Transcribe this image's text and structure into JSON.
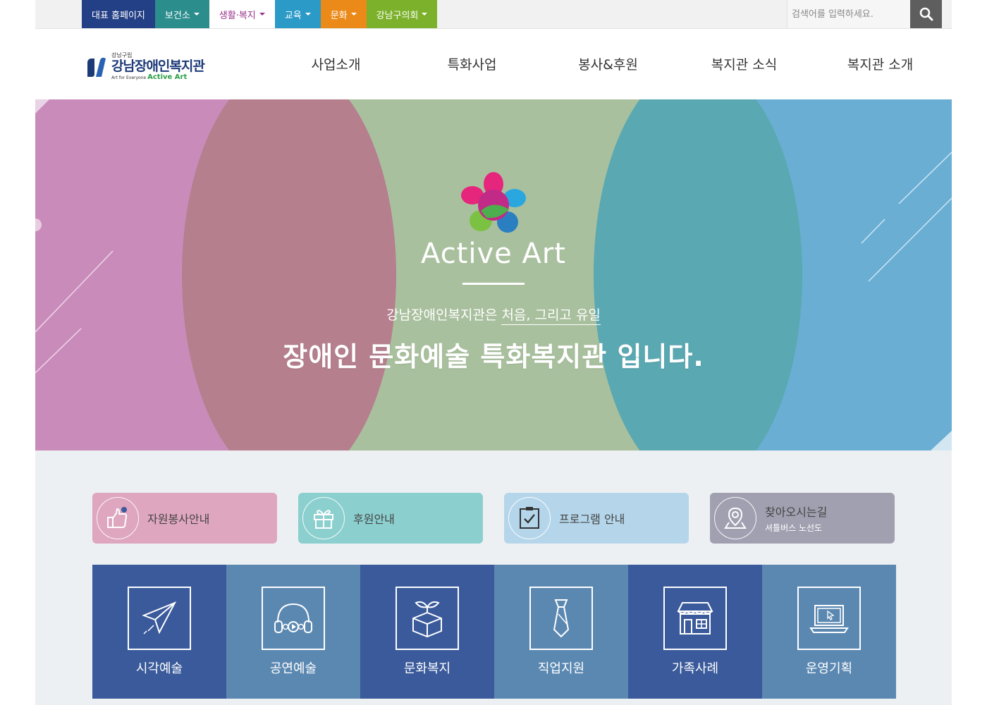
{
  "topnav": [
    {
      "label": "대표 홈페이지",
      "bg": "#233f86",
      "color": "#ffffff",
      "caret": false
    },
    {
      "label": "보건소",
      "bg": "#2c8d8d",
      "color": "#ffffff",
      "caret": true
    },
    {
      "label": "생활·복지",
      "bg": "#ffffff",
      "color": "#9a2f8a",
      "caret": true
    },
    {
      "label": "교육",
      "bg": "#2b9ac7",
      "color": "#ffffff",
      "caret": true
    },
    {
      "label": "문화",
      "bg": "#eb8a19",
      "color": "#ffffff",
      "caret": true
    },
    {
      "label": "강남구의회",
      "bg": "#7bb12b",
      "color": "#ffffff",
      "caret": true
    }
  ],
  "search": {
    "placeholder": "검색어를 입력하세요."
  },
  "logo": {
    "small": "강남구립",
    "main": "강남장애인복지관",
    "sub_prefix": "Art for Everyone ",
    "sub_brand": "Active Art"
  },
  "mainnav": [
    "사업소개",
    "특화사업",
    "봉사&후원",
    "복지관 소식",
    "복지관 소개"
  ],
  "hero": {
    "brand": "Active Art",
    "tagline_prefix": "강남장애인복지관은 ",
    "tagline_emph": "처음, 그리고 유일",
    "headline": "장애인 문화예술 특화복지관 입니다."
  },
  "quick": [
    {
      "label": "자원봉사안내",
      "sub": "",
      "bg": "#dea6bf",
      "icon": "thumbs-up-icon"
    },
    {
      "label": "후원안내",
      "sub": "",
      "bg": "#8ccfcf",
      "icon": "gift-icon"
    },
    {
      "label": "프로그램 안내",
      "sub": "",
      "bg": "#b5d6ea",
      "icon": "clipboard-check-icon"
    },
    {
      "label": "찾아오시는길",
      "sub": "셔틀버스 노선도",
      "bg": "#a1a0b1",
      "icon": "map-pin-icon"
    }
  ],
  "tiles": [
    {
      "label": "시각예술",
      "bg": "#3a5a9b",
      "icon": "paper-plane-icon"
    },
    {
      "label": "공연예술",
      "bg": "#5b88b1",
      "icon": "headphones-icon"
    },
    {
      "label": "문화복지",
      "bg": "#3a5a9b",
      "icon": "plant-box-icon"
    },
    {
      "label": "직업지원",
      "bg": "#5b88b1",
      "icon": "necktie-icon"
    },
    {
      "label": "가족사례",
      "bg": "#3a5a9b",
      "icon": "house-icon"
    },
    {
      "label": "운영기획",
      "bg": "#5b88b1",
      "icon": "laptop-icon"
    }
  ]
}
